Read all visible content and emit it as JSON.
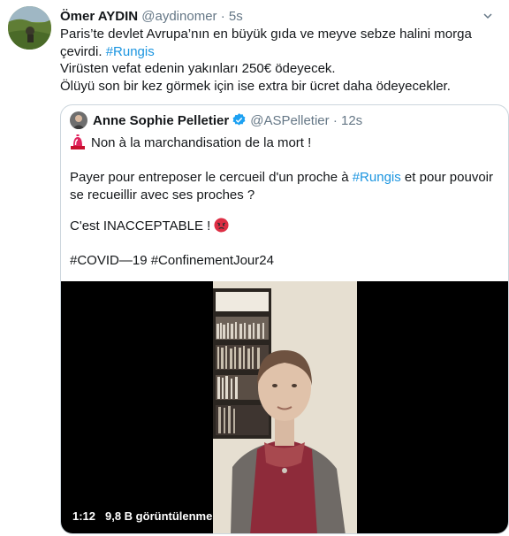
{
  "tweet": {
    "author_name": "Ömer AYDIN",
    "author_handle": "@aydinomer",
    "separator": "·",
    "time": "5s",
    "lines": {
      "line1": "Paris’te devlet Avrupa’nın en büyük gıda ve meyve sebze halini morga",
      "line2_prefix": "çevirdi. ",
      "line2_hashtag": "#Rungis",
      "line3": "Virüsten vefat edenin yakınları 250€ ödeyecek.",
      "line4": "Ölüyü son bir kez görmek için ise extra bir ücret daha ödeyecekler."
    }
  },
  "quote": {
    "author_name": "Anne Sophie Pelletier",
    "author_handle": "@ASPelletier",
    "separator": "·",
    "time": "12s",
    "line1": "Non à la marchandisation de la mort !",
    "line2_prefix": "Payer pour entreposer le cercueil d'un proche à ",
    "line2_hashtag": "#Rungis",
    "line2_suffix": " et pour pouvoir",
    "line3": "se recueillir avec ses proches ?",
    "line4": "C'est INACCEPTABLE ! ",
    "hashtag_line": "#COVID―19 #ConfinementJour24"
  },
  "video": {
    "duration": "1:12",
    "views": "9,8 B görüntülenme"
  },
  "icons": {
    "verified": "verified-badge-icon",
    "siren": "rotating-light-icon",
    "angry": "angry-face-icon",
    "more": "chevron-down-icon"
  },
  "colors": {
    "link": "#1b95e0",
    "secondary": "#657786",
    "border": "#ccd6dd",
    "verified": "#1da1f2"
  }
}
